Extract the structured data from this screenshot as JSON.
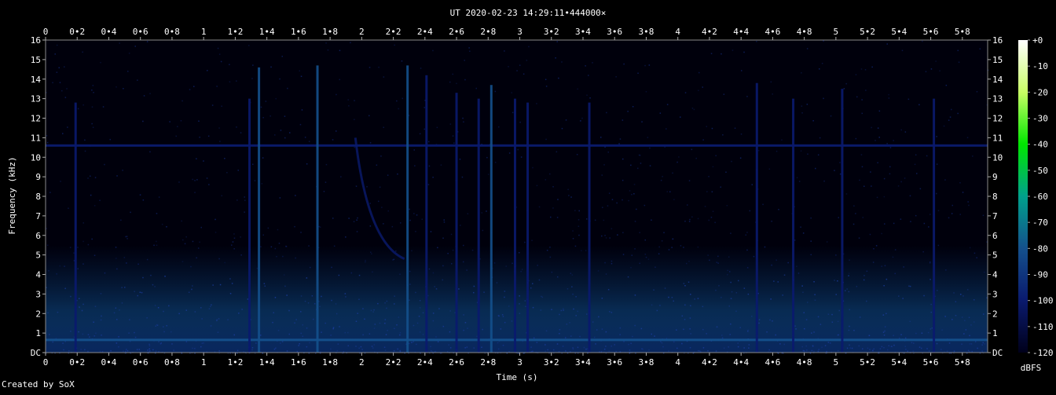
{
  "chart_data": {
    "type": "heatmap",
    "title": "UT 2020-02-23 14:29:11•444000×",
    "xlabel": "Time (s)",
    "ylabel": "Frequency (kHz)",
    "xlim": [
      0,
      5.96
    ],
    "ylim": [
      0,
      16
    ],
    "x_ticks": [
      "0",
      "0•2",
      "0•4",
      "0•6",
      "0•8",
      "1",
      "1•2",
      "1•4",
      "1•6",
      "1•8",
      "2",
      "2•2",
      "2•4",
      "2•6",
      "2•8",
      "3",
      "3•2",
      "3•4",
      "3•6",
      "3•8",
      "4",
      "4•2",
      "4•4",
      "4•6",
      "4•8",
      "5",
      "5•2",
      "5•4",
      "5•6",
      "5•8"
    ],
    "y_ticks": [
      "DC",
      "1",
      "2",
      "3",
      "4",
      "5",
      "6",
      "7",
      "8",
      "9",
      "10",
      "11",
      "12",
      "13",
      "14",
      "15",
      "16"
    ],
    "colorbar": {
      "label": "dBFS",
      "ticks": [
        "+0",
        "-10",
        "-20",
        "-30",
        "-40",
        "-50",
        "-60",
        "-70",
        "-80",
        "-90",
        "-100",
        "-110",
        "-120"
      ],
      "range": [
        -120,
        0
      ],
      "colors": [
        "#00001a",
        "#0a1a6e",
        "#14508c",
        "#00a08c",
        "#00e600",
        "#c8ff64",
        "#ffffff"
      ]
    },
    "features": {
      "horizontal_lines": [
        {
          "freq_khz": 10.6,
          "level_dbfs": -95
        },
        {
          "freq_khz": 0.65,
          "level_dbfs": -85
        }
      ],
      "vertical_transients": [
        {
          "t": 0.19,
          "fmax": 12.8,
          "level_dbfs": -100
        },
        {
          "t": 1.29,
          "fmax": 13.0,
          "level_dbfs": -100
        },
        {
          "t": 1.35,
          "fmax": 14.6,
          "level_dbfs": -85
        },
        {
          "t": 1.72,
          "fmax": 14.7,
          "level_dbfs": -80
        },
        {
          "t": 2.29,
          "fmax": 14.7,
          "level_dbfs": -85
        },
        {
          "t": 2.41,
          "fmax": 14.2,
          "level_dbfs": -95
        },
        {
          "t": 2.6,
          "fmax": 13.3,
          "level_dbfs": -95
        },
        {
          "t": 2.74,
          "fmax": 13.0,
          "level_dbfs": -95
        },
        {
          "t": 2.82,
          "fmax": 13.7,
          "level_dbfs": -88
        },
        {
          "t": 2.97,
          "fmax": 13.0,
          "level_dbfs": -95
        },
        {
          "t": 3.05,
          "fmax": 12.8,
          "level_dbfs": -95
        },
        {
          "t": 3.44,
          "fmax": 12.8,
          "level_dbfs": -100
        },
        {
          "t": 4.5,
          "fmax": 13.8,
          "level_dbfs": -95
        },
        {
          "t": 4.73,
          "fmax": 13.0,
          "level_dbfs": -100
        },
        {
          "t": 5.04,
          "fmax": 13.5,
          "level_dbfs": -95
        },
        {
          "t": 5.62,
          "fmax": 13.0,
          "level_dbfs": -100
        }
      ],
      "descending_sweep": {
        "t_start": 1.96,
        "f_start_khz": 11.0,
        "t_end": 2.27,
        "f_end_khz": 4.8,
        "level_dbfs": -100
      }
    }
  },
  "footer": {
    "credit": "Created by SoX"
  }
}
